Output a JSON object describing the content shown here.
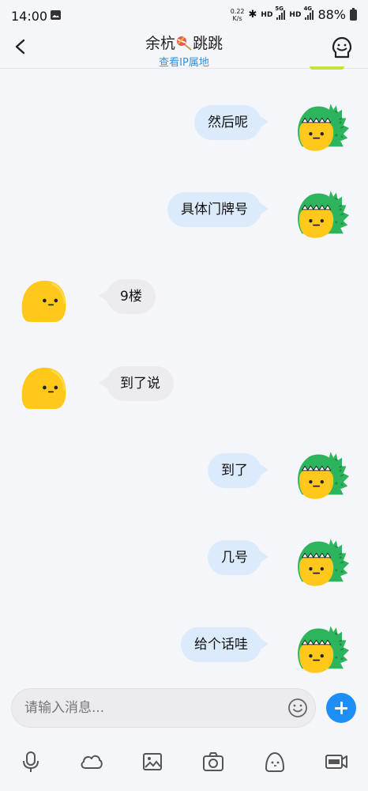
{
  "status_bar": {
    "time": "14:00",
    "net_speed_value": "0.22",
    "net_speed_unit": "K/s",
    "hd1": "HD",
    "sig1_label": "5G",
    "hd2": "HD",
    "sig2_label": "4G",
    "battery": "88%",
    "icons": [
      "image-icon",
      "bluetooth-icon",
      "signal-icon",
      "battery-icon"
    ]
  },
  "header": {
    "title_prefix": "余杭",
    "title_suffix": "跳跳",
    "subtitle": "查看IP属地"
  },
  "messages": [
    {
      "side": "out",
      "text": "然后呢"
    },
    {
      "side": "out",
      "text": "具体门牌号"
    },
    {
      "side": "in",
      "text": "9楼"
    },
    {
      "side": "in",
      "text": "到了说"
    },
    {
      "side": "out",
      "text": "到了"
    },
    {
      "side": "out",
      "text": "几号"
    },
    {
      "side": "out",
      "text": "给个话哇"
    }
  ],
  "input": {
    "placeholder": "请输入消息..."
  },
  "colors": {
    "accent": "#1c8ef5",
    "outgoing_bubble": "#dcebfb",
    "incoming_bubble": "#ececef",
    "link": "#3d8fd0",
    "avatar_yellow": "#ffc81a",
    "dino_green": "#2db55d"
  },
  "toolbar_icons": [
    "microphone-icon",
    "cloud-icon",
    "image-icon",
    "camera-icon",
    "sticker-icon",
    "gif-icon"
  ]
}
